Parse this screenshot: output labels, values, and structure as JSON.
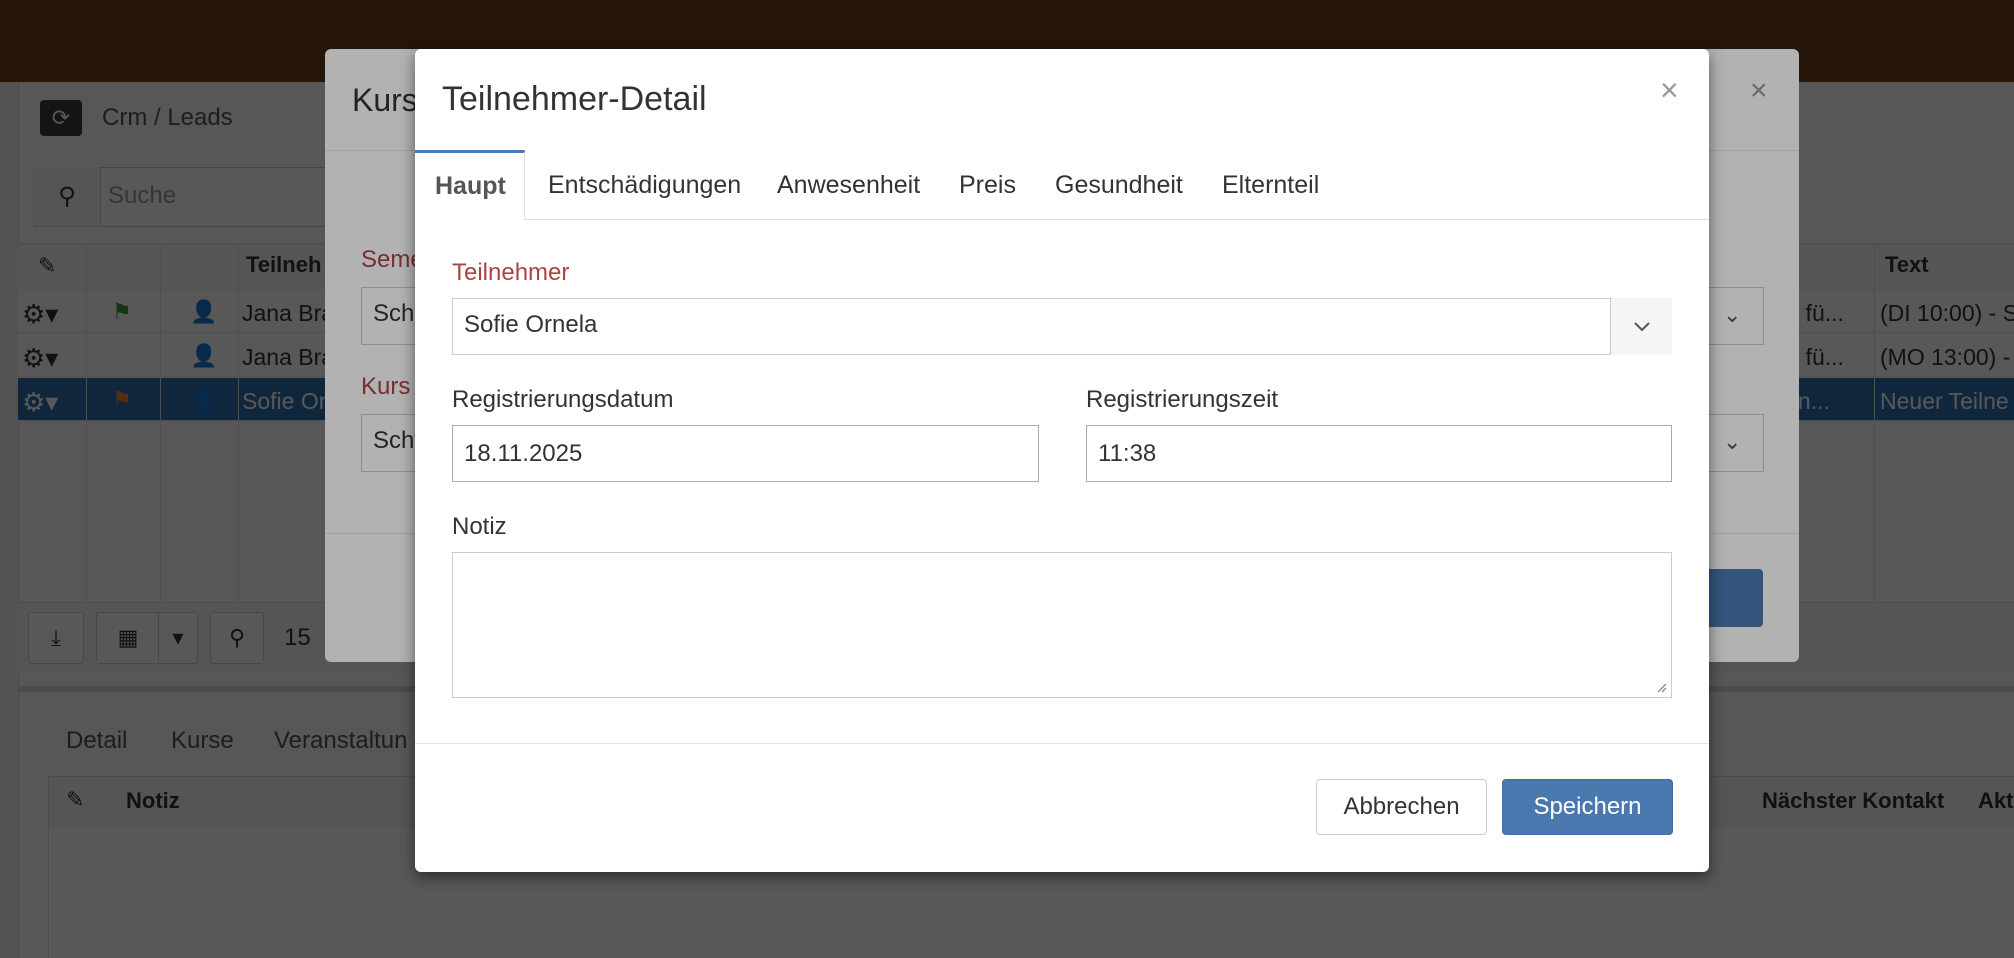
{
  "app": {
    "breadcrumb": "Crm / Leads",
    "search_placeholder": "Suche",
    "grid": {
      "headers": [
        "Teilneh",
        "Text"
      ],
      "rows": [
        {
          "name": "Jana Bra",
          "course": "rs fü...",
          "text": "(DI 10:00) - S",
          "flag_color": "#3a9d3a",
          "selected": false
        },
        {
          "name": "Jana Bra",
          "course": "rs fü...",
          "text": "(MO 13:00) -",
          "flag_color": "",
          "selected": false
        },
        {
          "name": "Sofie Or",
          "course": "ein...",
          "text": "Neuer Teilne",
          "flag_color": "#e68a2e",
          "selected": true
        }
      ]
    },
    "pager": {
      "page_size": "15"
    },
    "bottom_tabs": [
      "Detail",
      "Kurse",
      "Veranstaltun"
    ],
    "bottom_grid_headers": [
      "Notiz",
      "Nächster Kontakt",
      "Akt"
    ]
  },
  "modal_behind": {
    "title": "Kurs",
    "fields": [
      {
        "label": "Seme",
        "value": "Schu"
      },
      {
        "label": "Kurs",
        "value": "Schw"
      }
    ]
  },
  "modal": {
    "title": "Teilnehmer-Detail",
    "close": "×",
    "tabs": [
      {
        "label": "Haupt",
        "active": true
      },
      {
        "label": "Entschädigungen",
        "active": false
      },
      {
        "label": "Anwesenheit",
        "active": false
      },
      {
        "label": "Preis",
        "active": false
      },
      {
        "label": "Gesundheit",
        "active": false
      },
      {
        "label": "Elternteil",
        "active": false
      }
    ],
    "participant": {
      "label": "Teilnehmer",
      "value": "Sofie Ornela"
    },
    "reg_date": {
      "label": "Registrierungsdatum",
      "value": "18.11.2025"
    },
    "reg_time": {
      "label": "Registrierungszeit",
      "value": "11:38"
    },
    "note": {
      "label": "Notiz",
      "value": ""
    },
    "buttons": {
      "cancel": "Abbrechen",
      "save": "Speichern"
    },
    "colors": {
      "primary": "#4a79b0",
      "required": "#a94442",
      "topbar": "#6d3f1a"
    }
  }
}
